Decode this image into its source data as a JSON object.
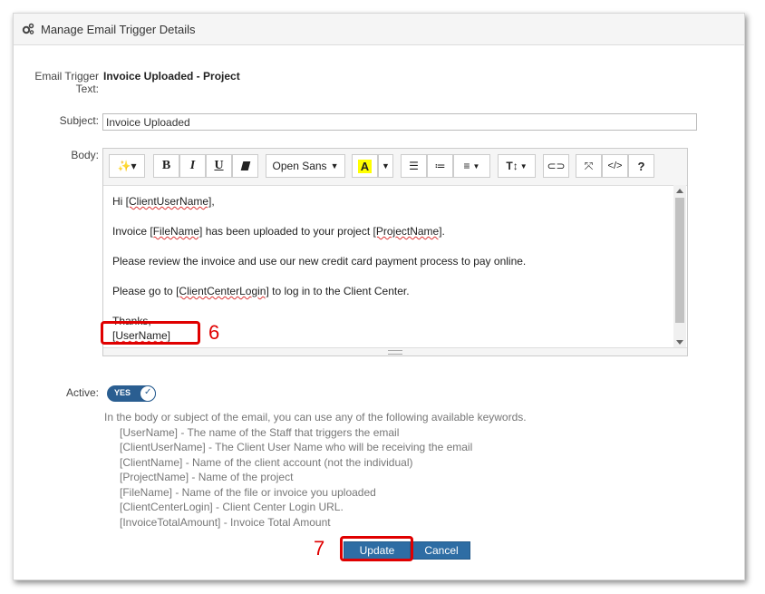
{
  "header": {
    "title": "Manage Email Trigger Details",
    "icon": "gears-icon"
  },
  "form": {
    "trigger_label_line1": "Email Trigger",
    "trigger_label_line2": "Text:",
    "trigger_value": "Invoice Uploaded - Project",
    "subject_label": "Subject:",
    "subject_value": "Invoice Uploaded",
    "body_label": "Body:",
    "active_label": "Active:",
    "active_toggle": "YES"
  },
  "toolbar": {
    "font_name": "Open Sans",
    "buttons": [
      "magic-wand",
      "bold",
      "italic",
      "underline",
      "eraser",
      "font-family",
      "highlight-color",
      "color-dropdown",
      "unordered-list",
      "ordered-list",
      "align",
      "text-size",
      "link",
      "fullscreen",
      "code-view",
      "help"
    ],
    "bold_label": "B",
    "italic_label": "I",
    "underline_label": "U",
    "highlight_label": "A",
    "textsize_label": "T↕",
    "code_label": "</>",
    "help_label": "?"
  },
  "body": {
    "line1_pre": "Hi ",
    "line1_kw": "[ClientUserName]",
    "line1_post": ",",
    "line2_pre": "Invoice ",
    "line2_kw1": "[FileName]",
    "line2_mid": " has been uploaded to your project ",
    "line2_kw2": "[ProjectName]",
    "line2_post": ".",
    "line3": "Please review the invoice and use our new credit card payment process to pay online.",
    "line4_pre": "Please go to ",
    "line4_kw": "[ClientCenterLogin]",
    "line4_post": " to log in to the Client Center.",
    "line5": "Thanks,",
    "line6": "[UserName]"
  },
  "help": {
    "intro": "In the body or subject of the email, you can use any of the following available keywords.",
    "keywords": [
      "[UserName] - The name of the Staff that triggers the email",
      "[ClientUserName] - The Client User Name who will be receiving the email",
      "[ClientName] - Name of the client account (not the individual)",
      "[ProjectName] - Name of the project",
      "[FileName] - Name of the file or invoice you uploaded",
      "[ClientCenterLogin] - Client Center Login URL.",
      "[InvoiceTotalAmount] - Invoice Total Amount"
    ]
  },
  "annotations": {
    "step6": "6",
    "step7": "7",
    "color": "#e00000"
  },
  "actions": {
    "update_label": "Update",
    "cancel_label": "Cancel"
  },
  "colors": {
    "primary_button": "#2e6da4",
    "toggle": "#2a5e91"
  }
}
